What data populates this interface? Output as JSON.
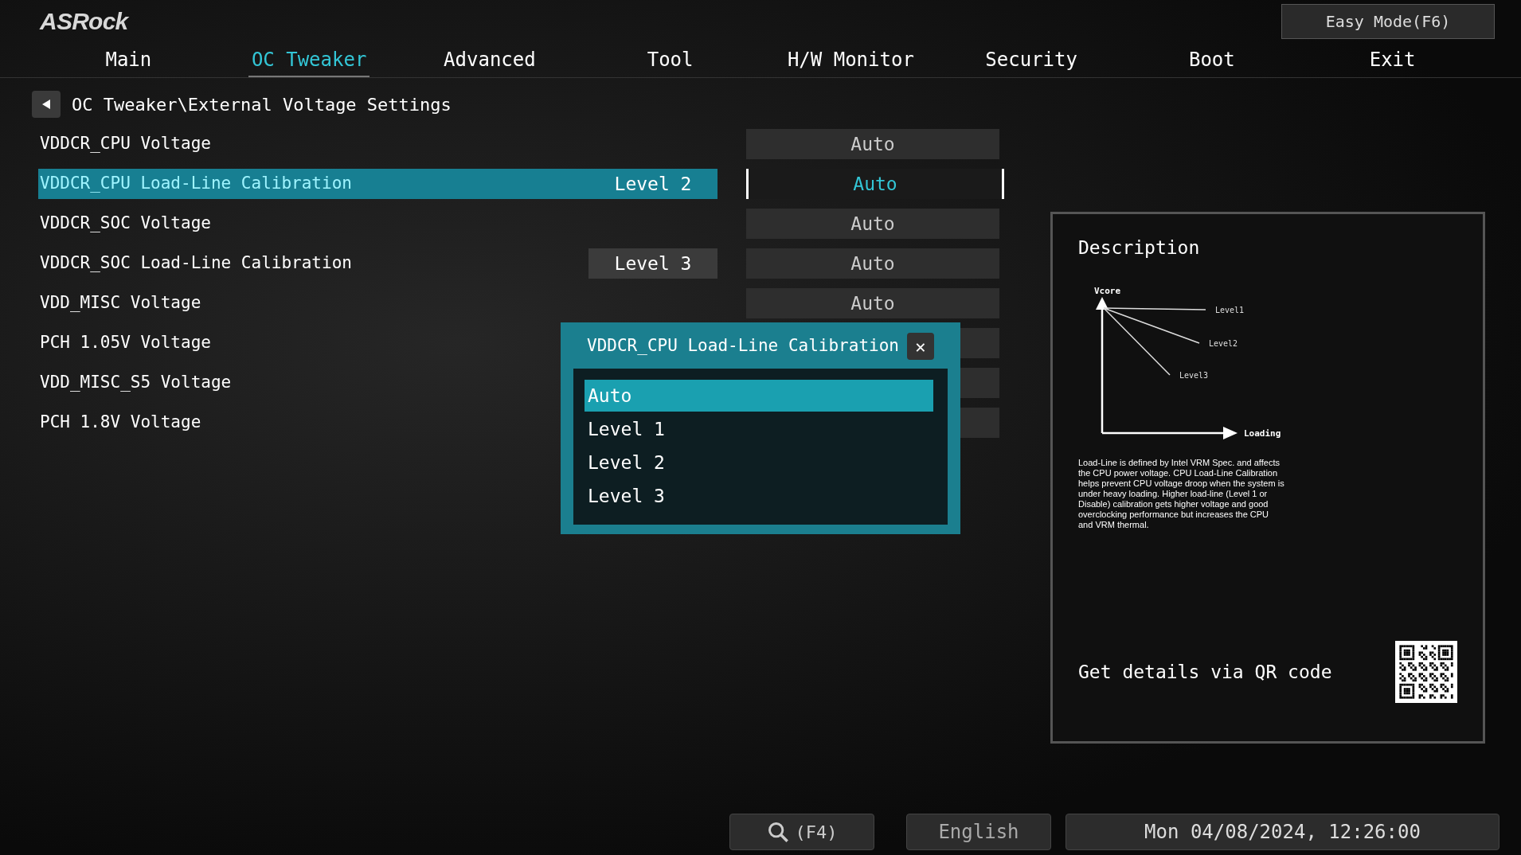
{
  "logo": "ASRock",
  "easy_mode_button": "Easy Mode(F6)",
  "tabs": [
    {
      "label": "Main",
      "selected": false
    },
    {
      "label": "OC Tweaker",
      "selected": true
    },
    {
      "label": "Advanced",
      "selected": false
    },
    {
      "label": "Tool",
      "selected": false
    },
    {
      "label": "H/W Monitor",
      "selected": false
    },
    {
      "label": "Security",
      "selected": false
    },
    {
      "label": "Boot",
      "selected": false
    },
    {
      "label": "Exit",
      "selected": false
    }
  ],
  "breadcrumb": "OC Tweaker\\External Voltage Settings",
  "settings": [
    {
      "label": "VDDCR_CPU Voltage",
      "value": "Auto",
      "selected": false
    },
    {
      "label": "VDDCR_CPU Load-Line Calibration",
      "current": "Level 2",
      "value": "Auto",
      "selected": true
    },
    {
      "label": "VDDCR_SOC Voltage",
      "value": "Auto",
      "selected": false
    },
    {
      "label": "VDDCR_SOC Load-Line Calibration",
      "current": "Level 3",
      "value": "Auto",
      "selected": false
    },
    {
      "label": "VDD_MISC Voltage",
      "value": "Auto",
      "selected": false
    },
    {
      "label": "PCH 1.05V Voltage",
      "selected": false
    },
    {
      "label": "VDD_MISC_S5 Voltage",
      "selected": false
    },
    {
      "label": "PCH 1.8V Voltage",
      "selected": false
    }
  ],
  "dialog": {
    "title": "VDDCR_CPU Load-Line Calibration",
    "close": "✕",
    "options": [
      {
        "label": "Auto",
        "selected": true
      },
      {
        "label": "Level 1",
        "selected": false
      },
      {
        "label": "Level 2",
        "selected": false
      },
      {
        "label": "Level 3",
        "selected": false
      }
    ]
  },
  "description": {
    "title": "Description",
    "diagram": {
      "y_axis": "Vcore",
      "x_axis": "Loading",
      "lines": [
        "Level1",
        "Level2",
        "Level3"
      ]
    },
    "text": "Load-Line is defined by Intel VRM Spec. and affects the CPU power voltage. CPU Load-Line Calibration helps prevent CPU voltage droop when the system is under heavy loading. Higher load-line (Level 1 or Disable) calibration gets higher voltage and good overclocking performance but increases the CPU and VRM thermal.",
    "qr_label": "Get details via QR code"
  },
  "status_bar": {
    "search": "(F4)",
    "language": "English",
    "datetime": "Mon 04/08/2024, 12:26:00"
  }
}
